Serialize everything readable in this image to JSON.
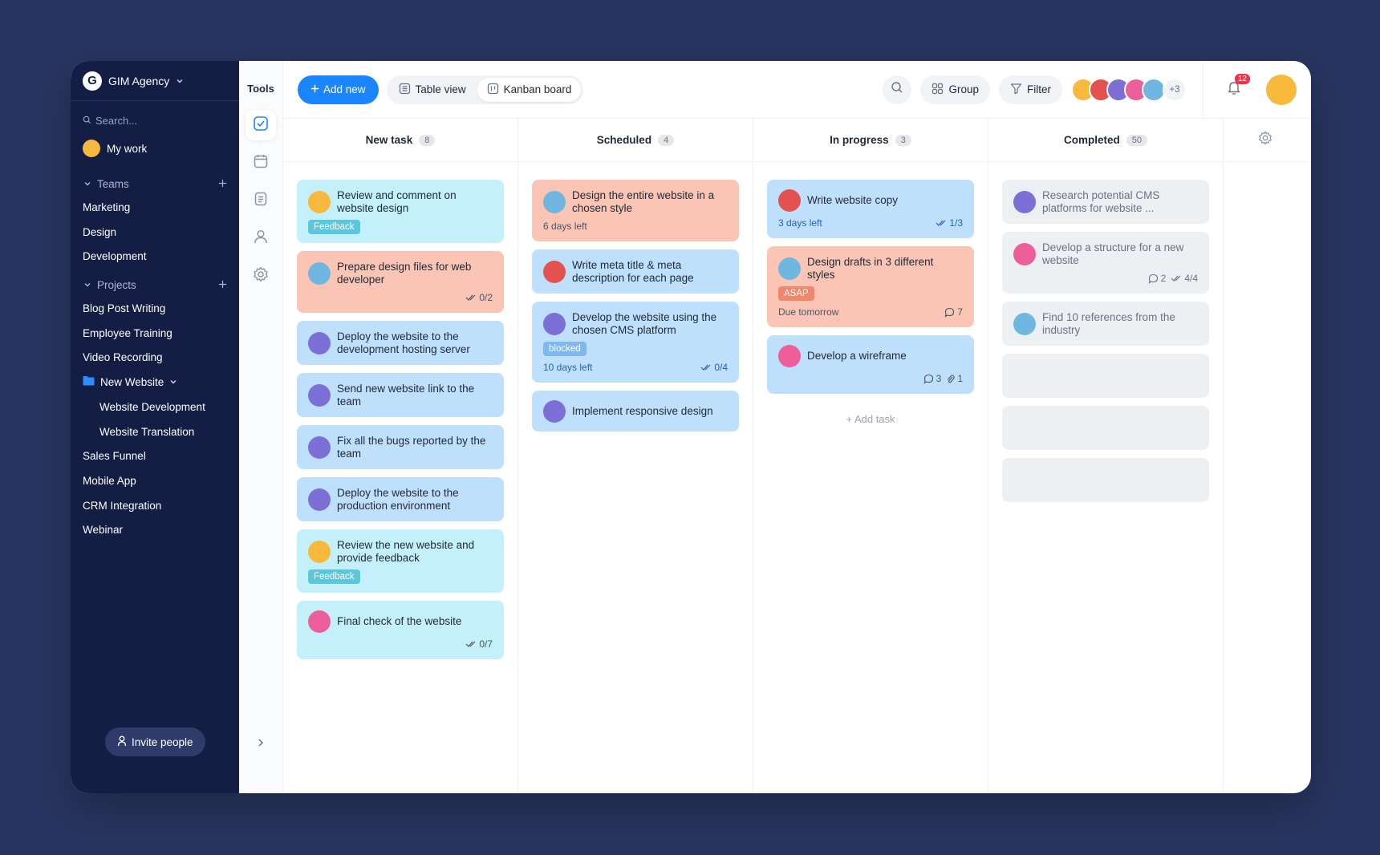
{
  "sidebar": {
    "workspace": "GIM Agency",
    "search_placeholder": "Search...",
    "my_work": "My work",
    "teams_label": "Teams",
    "teams": [
      "Marketing",
      "Design",
      "Development"
    ],
    "projects_label": "Projects",
    "projects_top": [
      "Blog Post Writing",
      "Employee Training",
      "Video Recording"
    ],
    "folder": "New Website",
    "folder_items": [
      "Website Development",
      "Website Translation"
    ],
    "projects_bottom": [
      "Sales Funnel",
      "Mobile App",
      "CRM Integration",
      "Webinar"
    ],
    "invite": "Invite people"
  },
  "tools": {
    "title": "Tools"
  },
  "topbar": {
    "add_new": "Add new",
    "table_view": "Table view",
    "kanban_board": "Kanban board",
    "group": "Group",
    "filter": "Filter",
    "more_members": "+3",
    "notifications": "12"
  },
  "colors": {
    "accent": "#1a85ff",
    "sidebar_bg": "#141e45",
    "background": "#283560",
    "card_cyan": "#c3f0fb",
    "card_blue": "#bfe0fd",
    "card_salmon": "#fbc5b5",
    "card_gray": "#edf0f3"
  },
  "board": {
    "columns": [
      {
        "name": "New task",
        "count": "8",
        "cards": [
          {
            "title": "Review and comment on website design",
            "color": "cyan",
            "avatar": "#f6b93b",
            "tag": "Feedback",
            "tag_color": "#5bc6dc"
          },
          {
            "title": "Prepare design files for web developer",
            "color": "salmon",
            "avatar": "#6fb7e0",
            "checks": "0/2"
          },
          {
            "title": "Deploy the website to the development hosting server",
            "color": "blue",
            "avatar": "#7c6fd6"
          },
          {
            "title": "Send new website link to the team",
            "color": "blue",
            "avatar": "#7c6fd6"
          },
          {
            "title": "Fix all the bugs reported by the team",
            "color": "blue",
            "avatar": "#7c6fd6"
          },
          {
            "title": "Deploy the website to the production environment",
            "color": "blue",
            "avatar": "#7c6fd6"
          },
          {
            "title": "Review the new website and provide feedback",
            "color": "cyan",
            "avatar": "#f6b93b",
            "tag": "Feedback",
            "tag_color": "#5bc6dc"
          },
          {
            "title": "Final check of the website",
            "color": "cyan",
            "avatar": "#ec5f9a",
            "checks": "0/7"
          }
        ]
      },
      {
        "name": "Scheduled",
        "count": "4",
        "cards": [
          {
            "title": "Design the entire website in a chosen style",
            "color": "salmon",
            "avatar": "#6fb7e0",
            "due": "6 days left"
          },
          {
            "title": "Write meta title & meta description for each page",
            "color": "blue",
            "avatar": "#e4524f"
          },
          {
            "title": "Develop the website using the chosen CMS platform",
            "color": "blue",
            "avatar": "#7c6fd6",
            "tag": "blocked",
            "tag_color": "#7eb8ee",
            "due": "10 days left",
            "checks": "0/4"
          },
          {
            "title": "Implement responsive design",
            "color": "blue",
            "avatar": "#7c6fd6"
          }
        ]
      },
      {
        "name": "In progress",
        "count": "3",
        "cards": [
          {
            "title": "Write website copy",
            "color": "blue",
            "avatar": "#e4524f",
            "due": "3 days left",
            "checks": "1/3"
          },
          {
            "title": "Design drafts in 3 different styles",
            "color": "salmon",
            "avatar": "#6fb7e0",
            "tag": "ASAP",
            "tag_color": "#f0876a",
            "due": "Due tomorrow",
            "comments": "7"
          },
          {
            "title": "Develop a wireframe",
            "color": "blue",
            "avatar": "#ec5f9a",
            "comments": "3",
            "attachments": "1"
          }
        ],
        "add_task": "Add task"
      },
      {
        "name": "Completed",
        "count": "50",
        "cards": [
          {
            "title": "Research potential CMS platforms for website ...",
            "color": "gray",
            "avatar": "#7c6fd6"
          },
          {
            "title": "Develop a structure for a new website",
            "color": "gray",
            "avatar": "#ec5f9a",
            "comments": "2",
            "checks": "4/4"
          },
          {
            "title": "Find 10 references from the industry",
            "color": "gray",
            "avatar": "#6fb7e0"
          }
        ],
        "placeholders": 3
      }
    ]
  }
}
